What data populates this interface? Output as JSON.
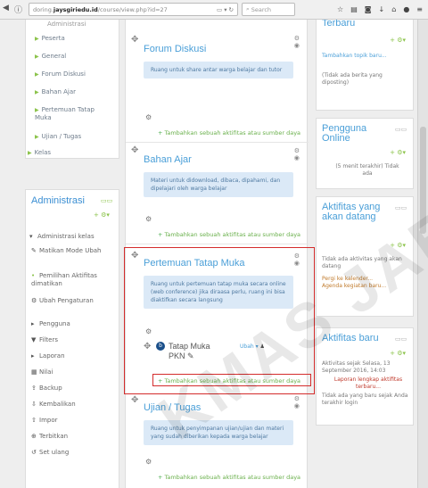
{
  "browser": {
    "url_prefix": "doring.",
    "url_domain": "jaysgiriedu.id",
    "url_path": "/course/view.php?id=27",
    "search_placeholder": "Search"
  },
  "left_nav": {
    "top_cut": "Administrasi",
    "items": [
      "Peserta",
      "General",
      "Forum Diskusi",
      "Bahan Ajar",
      "Pertemuan Tatap Muka",
      "Ujian / Tugas"
    ],
    "kelas": "Kelas"
  },
  "admin_block": {
    "title": "Administrasi",
    "kelas_header": "Administrasi kelas",
    "items": [
      {
        "icon": "pencil-icon",
        "label": "Matikan Mode Ubah"
      },
      {
        "icon": "bullet-icon",
        "label": "Pemilihan Aktifitas dimatikan"
      },
      {
        "icon": "gear-icon",
        "label": "Ubah Pengaturan"
      },
      {
        "icon": "arrow-icon",
        "label": "Pengguna"
      },
      {
        "icon": "filter-icon",
        "label": "Filters"
      },
      {
        "icon": "arrow-icon",
        "label": "Laporan"
      },
      {
        "icon": "grid-icon",
        "label": "Nilai"
      },
      {
        "icon": "backup-icon",
        "label": "Backup"
      },
      {
        "icon": "restore-icon",
        "label": "Kembalikan"
      },
      {
        "icon": "import-icon",
        "label": "Impor"
      },
      {
        "icon": "publish-icon",
        "label": "Terbitkan"
      },
      {
        "icon": "reset-icon",
        "label": "Set ulang"
      }
    ]
  },
  "sections": [
    {
      "title": "Forum Diskusi",
      "desc": "Ruang untuk share antar warga belajar dan tutor",
      "add": "Tambahkan sebuah aktifitas atau sumber daya"
    },
    {
      "title": "Bahan Ajar",
      "desc": "Materi untuk didownload, dibaca, dipahami, dan dipelajari oleh warga belajar",
      "add": "Tambahkan sebuah aktifitas atau sumber daya"
    },
    {
      "title": "Pertemuan Tatap Muka",
      "desc": "Ruang untuk pertemuan tatap muka secara online (web conference) jika diraasa perlu, ruang ini bisa diaktifkan secara langsung",
      "activity": "Tatap Muka PKN",
      "activity_edit": "Ubah",
      "add": "Tambahkan sebuah aktifitas atau sumber daya"
    },
    {
      "title": "Ujian / Tugas",
      "desc": "Ruang untuk penyimpanan ujian/ujian dan materi yang sudah diberikan kepada warga belajar",
      "add": "Tambahkan sebuah aktifitas atau sumber daya"
    }
  ],
  "right": {
    "terbaru_title": "Terbaru",
    "terbaru_link": "Tambahkan topik baru...",
    "terbaru_text": "(Tidak ada berita yang diposting)",
    "online_title": "Pengguna Online",
    "online_text": "(5 menit terakhir) Tidak ada",
    "aktivitas_title": "Aktifitas yang akan datang",
    "aktivitas_text": "Tidak ada aktivitas yang akan datang",
    "aktivitas_links": "Pergi ke kalender... Agenda kegiatan baru...",
    "recent_title": "Aktifitas baru",
    "recent_text": "Aktivitas sejak Selasa, 13 September 2016, 14:03",
    "recent_link": "Laporan lengkap aktifitas terbaru...",
    "recent_text2": "Tidak ada yang baru sejak Anda terakhir login"
  },
  "watermark": "KMAS JAB"
}
